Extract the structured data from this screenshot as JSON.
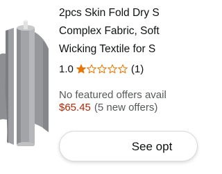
{
  "product": {
    "title_lines": [
      "2pcs Skin Fold Dry S",
      "Complex Fabric, Soft",
      "Wicking Textile for S"
    ],
    "rating_value": "1.0",
    "rating_stars": 1,
    "rating_max": 5,
    "rating_count": "(1)",
    "offer_note": "No featured offers avail",
    "price": "$65.45",
    "new_offers": "(5 new offers)",
    "button_label": "See opt"
  },
  "colors": {
    "star": "#e77600",
    "price": "#b12704",
    "fabric": "#8e8f92"
  }
}
